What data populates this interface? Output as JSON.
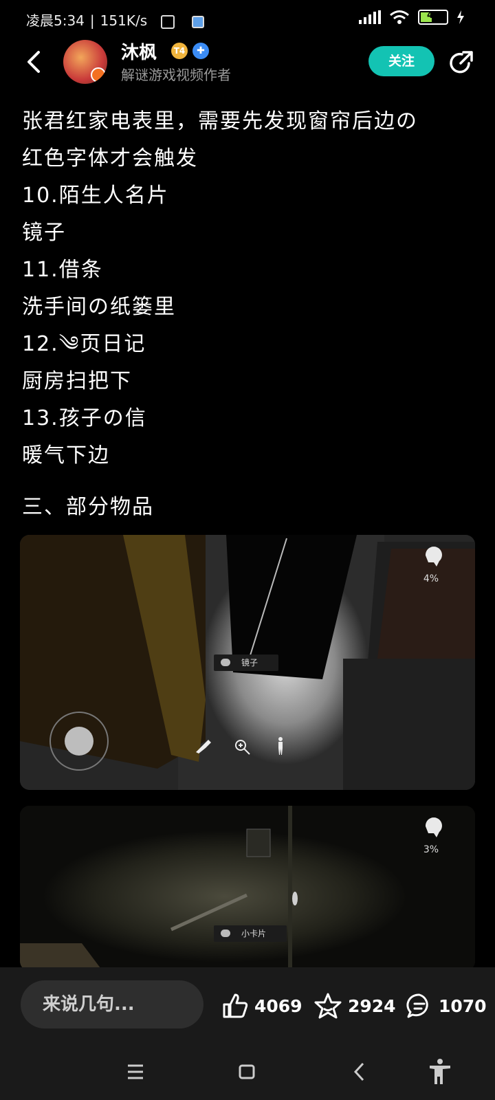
{
  "status": {
    "time": "凌晨5:34",
    "speed": "151K/s",
    "battery": "40"
  },
  "header": {
    "author": "沐枫",
    "level_badge": "T4",
    "subtitle": "解谜游戏视频作者",
    "follow_label": "关注"
  },
  "article": {
    "lines": [
      "张君红家电表里，需要先发现窗帘后边の",
      "红色字体才会触发",
      "10.陌生人名片",
      "镜子",
      "11.借条",
      "洗手间の纸篓里",
      "12.༄页日记",
      "厨房扫把下",
      "13.孩子の信",
      "暖气下边"
    ],
    "section_title": "三、部分物品"
  },
  "screenshots": [
    {
      "sanity": "4%",
      "item_label": "镜子"
    },
    {
      "sanity": "3%",
      "item_label": "小卡片"
    }
  ],
  "bottom": {
    "comment_placeholder": "来说几句...",
    "likes": "4069",
    "favorites": "2924",
    "comments": "1070"
  }
}
